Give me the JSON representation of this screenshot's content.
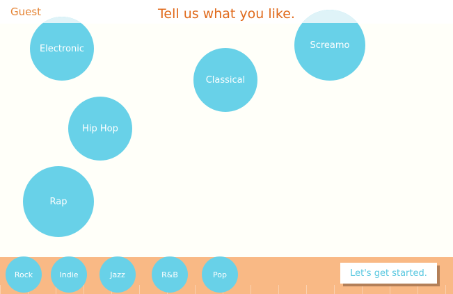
{
  "header": {
    "user_label": "Guest",
    "prompt": "Tell us what you like."
  },
  "genres": {
    "electronic": "Electronic",
    "classical": "Classical",
    "screamo": "Screamo",
    "hip_hop": "Hip Hop",
    "rap": "Rap"
  },
  "tray": {
    "rock": "Rock",
    "indie": "Indie",
    "jazz": "Jazz",
    "rnb": "R&B",
    "pop": "Pop"
  },
  "actions": {
    "start_label": "Let's get started."
  },
  "colors": {
    "accent_orange": "#e06a1b",
    "bubble_blue": "#68d1e8",
    "tray_peach": "#f9b985",
    "background": "#fffff9"
  }
}
